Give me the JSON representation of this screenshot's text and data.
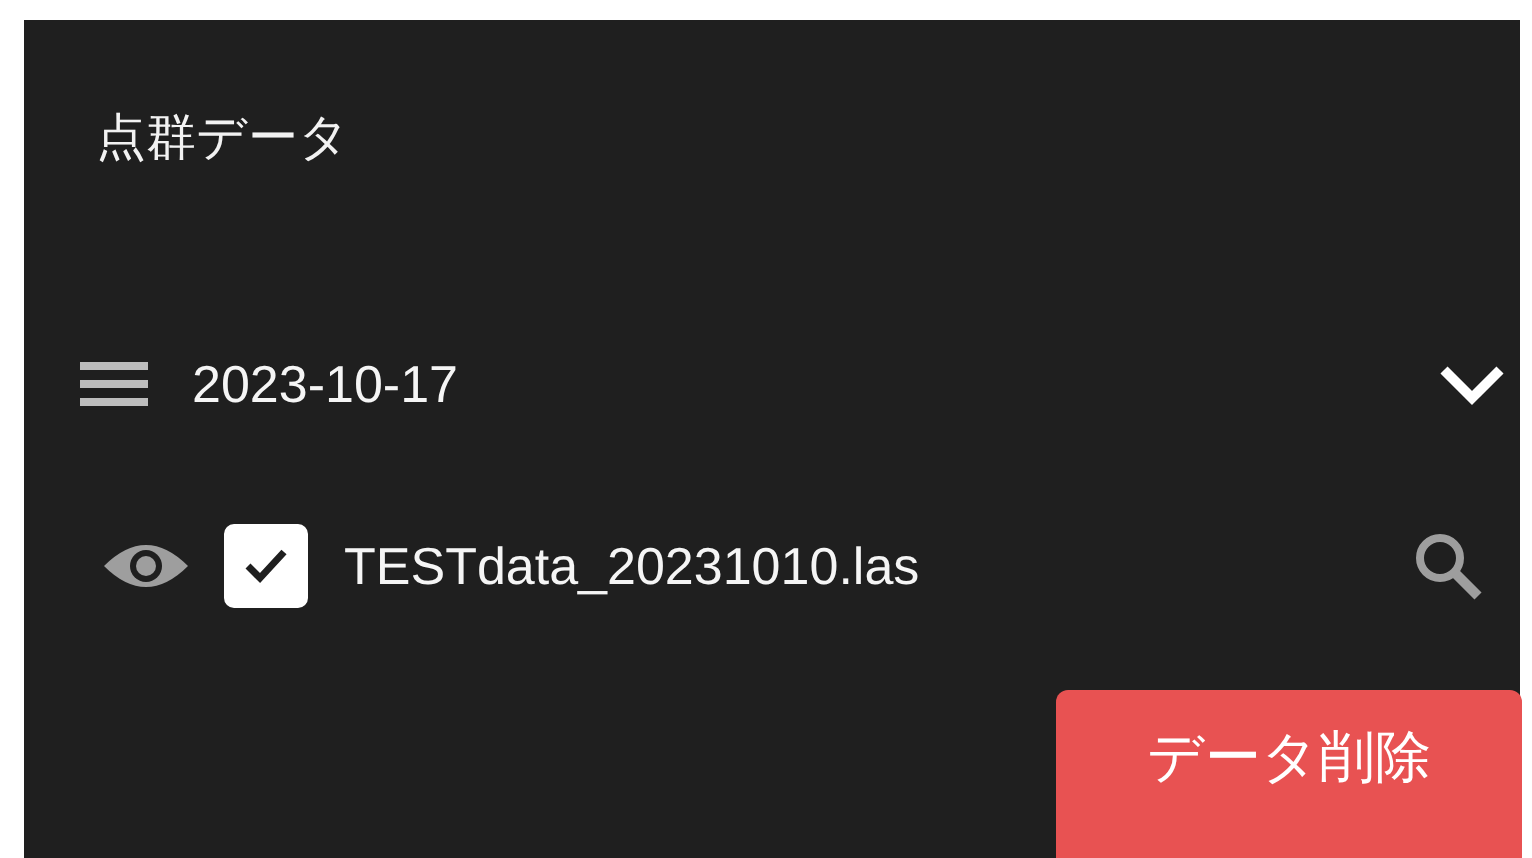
{
  "panel": {
    "title": "点群データ"
  },
  "groups": [
    {
      "label": "2023-10-17",
      "expanded": true,
      "items": [
        {
          "name": "TESTdata_20231010.las",
          "visible": true,
          "checked": true
        }
      ]
    }
  ],
  "delete_button": {
    "label": "データ削除"
  }
}
